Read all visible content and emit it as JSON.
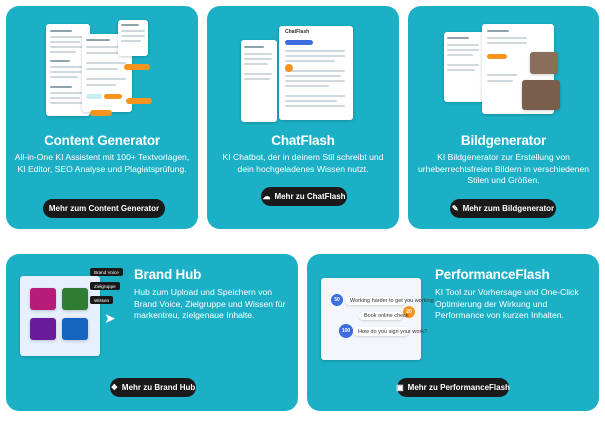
{
  "cards": [
    {
      "title": "Content Generator",
      "description": "All-in-One KI Assistent mit 100+ Textvorlagen, KI Editor, SEO Analyse und Plagiatsprüfung.",
      "button": "Mehr zum Content Generator"
    },
    {
      "title": "ChatFlash",
      "description": "KI Chatbot, der in deinem Stil schreibt und dein hochgeladenes Wissen nutzt.",
      "button": "Mehr zu ChatFlash",
      "mock": {
        "panel_title": "ChatFlash"
      }
    },
    {
      "title": "Bildgenerator",
      "description": "KI Bildgenerator zur Erstellung von urheberrechtsfreien Bildern in verschiedenen Stilen und Größen.",
      "button": "Mehr zum Bildgenerator"
    },
    {
      "title": "Brand Hub",
      "description": "Hub zum Upload und Speichern von Brand Voice, Zielgruppe und Wissen für markentreu, zielgenaue Inhalte.",
      "button": "Mehr zu Brand Hub",
      "mock": {
        "tags": [
          "Brand Voice",
          "Zielgruppe",
          "Wissen"
        ]
      }
    },
    {
      "title": "PerformanceFlash",
      "description": "KI Tool zur Vorhersage und One-Click Optimierung der Wirkung und Performance von kurzen Inhalten.",
      "button": "Mehr zu PerformanceFlash",
      "mock": {
        "scores": [
          "50",
          "20",
          "100"
        ],
        "messages": [
          "Working harder to get you working",
          "Book online check",
          "How do you sign your work?"
        ]
      }
    }
  ],
  "icons": [
    "chat-icon",
    "image-icon",
    "hub-icon",
    "performance-icon"
  ],
  "colors": {
    "card_bg": "#1bb0c6",
    "button_bg": "#1a1a1a",
    "accent_orange": "#f7941d",
    "accent_blue": "#3d6ee0"
  }
}
